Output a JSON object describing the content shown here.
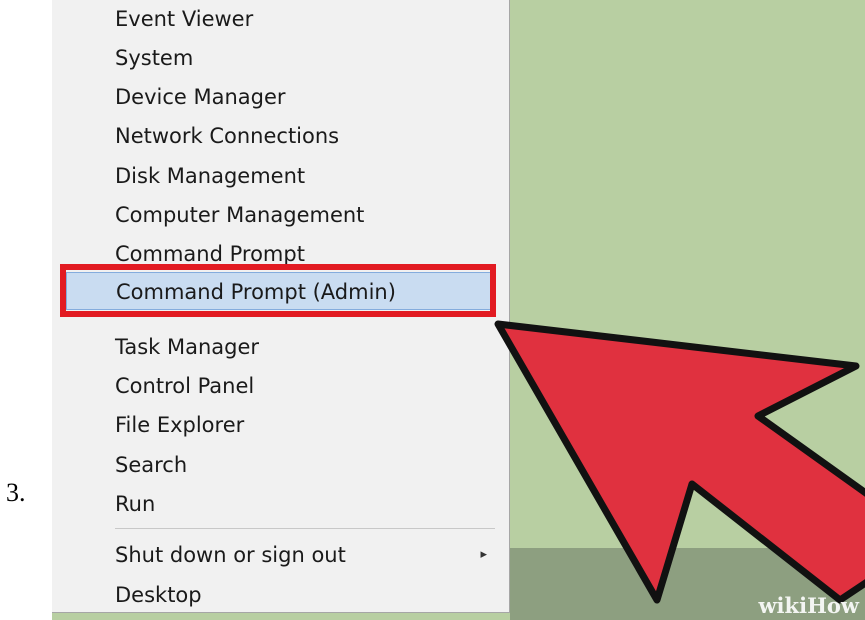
{
  "step": {
    "number": "3."
  },
  "menu": {
    "items": [
      {
        "label": "Event Viewer"
      },
      {
        "label": "System"
      },
      {
        "label": "Device Manager"
      },
      {
        "label": "Network Connections"
      },
      {
        "label": "Disk Management"
      },
      {
        "label": "Computer Management"
      },
      {
        "label": "Command Prompt"
      },
      {
        "label": "Command Prompt (Admin)",
        "selected": true
      },
      {
        "label": "Task Manager"
      },
      {
        "label": "Control Panel"
      },
      {
        "label": "File Explorer"
      },
      {
        "label": "Search"
      },
      {
        "label": "Run"
      },
      {
        "label": "Shut down or sign out",
        "submenu": true
      },
      {
        "label": "Desktop"
      }
    ],
    "submenu_glyph": "▸"
  },
  "annotation": {
    "highlight_color": "#e21b22",
    "arrow_color": "#e0313f"
  },
  "watermark": {
    "text": "wikiHow"
  },
  "colors": {
    "background": "#b8cfa2",
    "menu_background": "#f1f1f1",
    "selected_background": "#c9dcf1"
  }
}
